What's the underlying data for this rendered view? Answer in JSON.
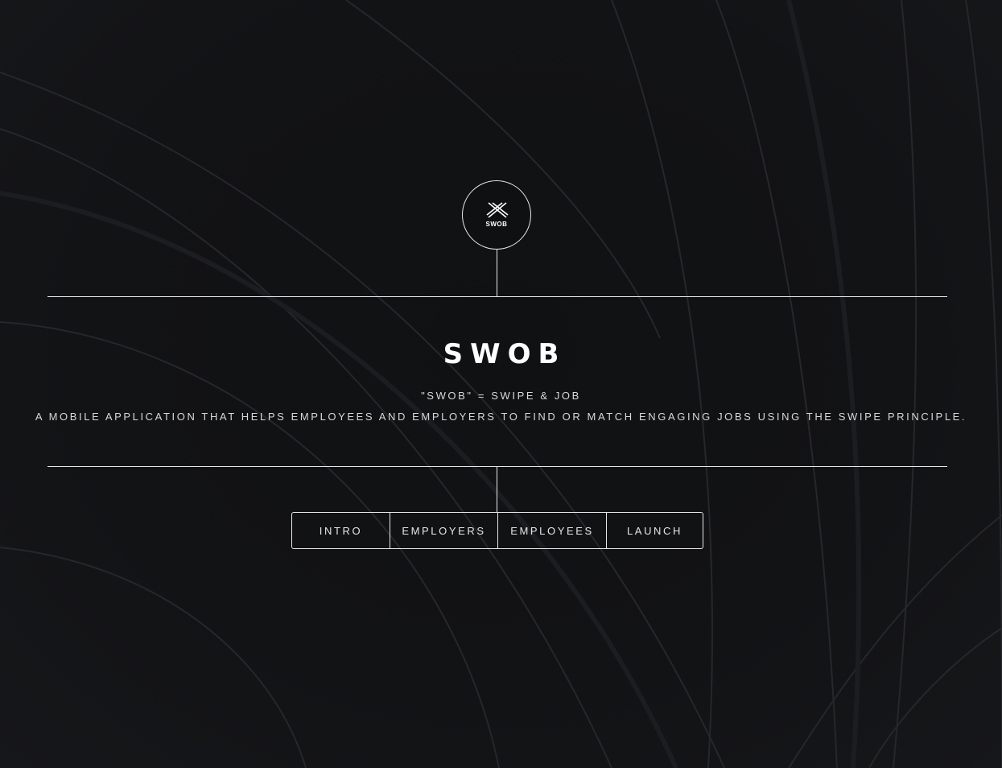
{
  "brand": {
    "logo_text": "SWOB",
    "logo_icon": "swob-x-logo-icon"
  },
  "hero": {
    "title": "SWOB",
    "tagline": "\"SWOB\" = SWIPE & JOB",
    "description": "A MOBILE APPLICATION THAT HELPS EMPLOYEES AND EMPLOYERS TO FIND OR MATCH ENGAGING JOBS USING THE SWIPE PRINCIPLE."
  },
  "nav": {
    "items": [
      {
        "label": "INTRO"
      },
      {
        "label": "EMPLOYERS"
      },
      {
        "label": "EMPLOYEES"
      },
      {
        "label": "LAUNCH"
      }
    ]
  },
  "colors": {
    "background": "#0f1012",
    "line": "#e8e8e8",
    "text": "#ffffff"
  }
}
